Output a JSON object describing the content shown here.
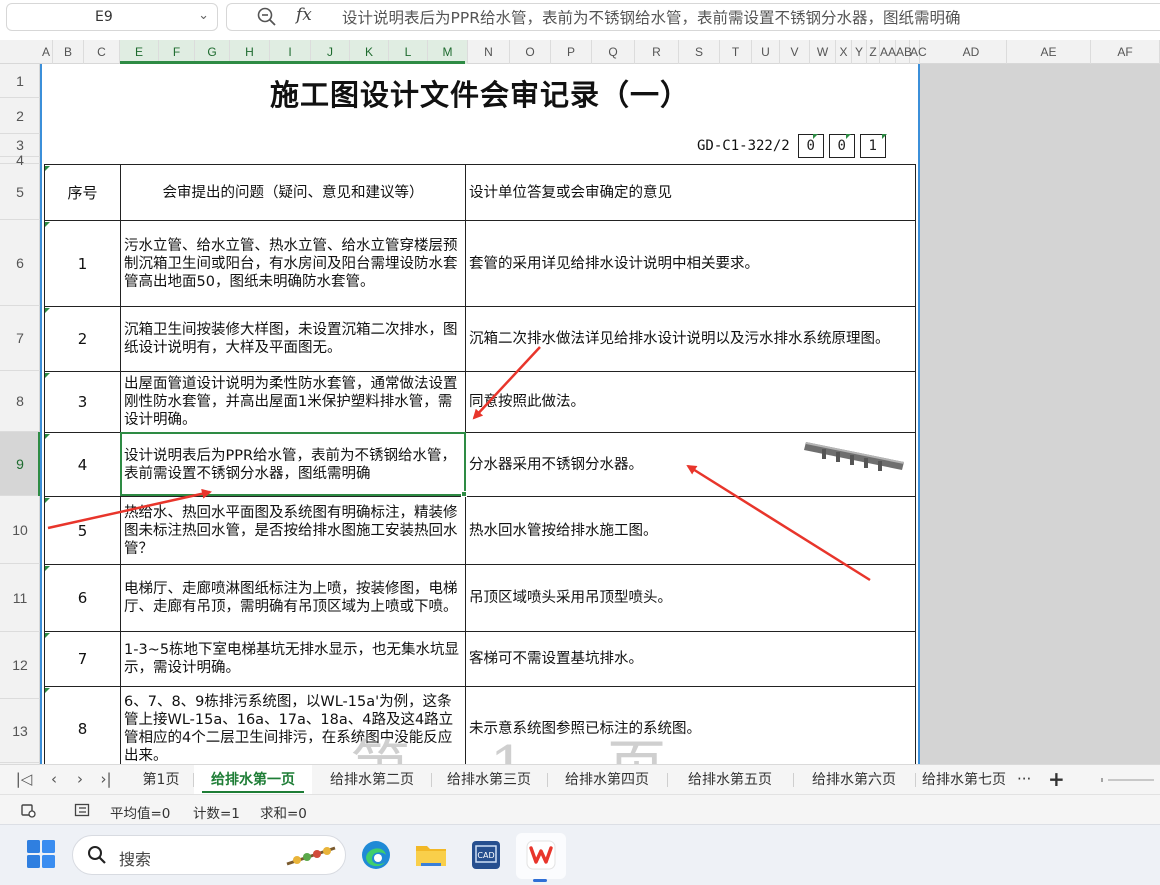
{
  "formula_bar": {
    "cell_ref": "E9",
    "fx_label": "fx",
    "formula": "设计说明表后为PPR给水管，表前为不锈钢给水管，表前需设置不锈钢分水器，图纸需明确"
  },
  "columns": [
    "A",
    "B",
    "C",
    "E",
    "F",
    "G",
    "H",
    "I",
    "J",
    "K",
    "L",
    "M",
    "N",
    "O",
    "P",
    "Q",
    "R",
    "S",
    "T",
    "U",
    "V",
    "W",
    "X",
    "Y",
    "Z",
    "AA",
    "AB",
    "AC",
    "AD",
    "AE",
    "AF"
  ],
  "rows": [
    "1",
    "2",
    "3",
    "4",
    "5",
    "6",
    "7",
    "8",
    "9",
    "10",
    "11",
    "12",
    "13"
  ],
  "document": {
    "title": "施工图设计文件会审记录（一）",
    "code": "GD-C1-322/2",
    "code_boxes": [
      "0",
      "0",
      "1"
    ],
    "headers": {
      "no": "序号",
      "question": "会审提出的问题（疑问、意见和建议等）",
      "answer": "设计单位答复或会审确定的意见"
    },
    "items": [
      {
        "no": "1",
        "question": "污水立管、给水立管、热水立管、给水立管穿楼层预制沉箱卫生间或阳台，有水房间及阳台需埋设防水套管高出地面50，图纸未明确防水套管。",
        "answer": "套管的采用详见给排水设计说明中相关要求。"
      },
      {
        "no": "2",
        "question": "沉箱卫生间按装修大样图，未设置沉箱二次排水，图纸设计说明有，大样及平面图无。",
        "answer": "沉箱二次排水做法详见给排水设计说明以及污水排水系统原理图。"
      },
      {
        "no": "3",
        "question": "出屋面管道设计说明为柔性防水套管，通常做法设置刚性防水套管，并高出屋面1米保护塑料排水管，需设计明确。",
        "answer": "同意按照此做法。"
      },
      {
        "no": "4",
        "question": "设计说明表后为PPR给水管，表前为不锈钢给水管，表前需设置不锈钢分水器，图纸需明确",
        "answer": "分水器采用不锈钢分水器。"
      },
      {
        "no": "5",
        "question": "热给水、热回水平面图及系统图有明确标注，精装修图未标注热回水管，是否按给排水图施工安装热回水管？",
        "answer": "热水回水管按给排水施工图。"
      },
      {
        "no": "6",
        "question": "电梯厅、走廊喷淋图纸标注为上喷，按装修图，电梯厅、走廊有吊顶，需明确有吊顶区域为上喷或下喷。",
        "answer": "吊顶区域喷头采用吊顶型喷头。"
      },
      {
        "no": "7",
        "question": "1-3~5栋地下室电梯基坑无排水显示，也无集水坑显示，需设计明确。",
        "answer": "客梯可不需设置基坑排水。"
      },
      {
        "no": "8",
        "question": "6、7、8、9栋排污系统图，以WL-15a'为例，这条管上接WL-15a、16a、17a、18a、4路及这4路立管相应的4个二层卫生间排污，在系统图中没能反应出来。",
        "answer": "未示意系统图参照已标注的系统图。"
      }
    ],
    "watermark": "第 1 页"
  },
  "sheet_tabs": {
    "tabs": [
      "第1页",
      "给排水第一页",
      "给排水第二页",
      "给排水第三页",
      "给排水第四页",
      "给排水第五页",
      "给排水第六页",
      "给排水第七页"
    ],
    "active": "给排水第一页",
    "more": "···",
    "add": "+"
  },
  "status_bar": {
    "average": "平均值=0",
    "count": "计数=1",
    "sum": "求和=0"
  },
  "taskbar": {
    "search_label": "搜索",
    "apps": [
      "edge-icon",
      "file-explorer-icon",
      "cad-icon",
      "wps-icon"
    ]
  },
  "colors": {
    "accent_green": "#2e8b44",
    "page_border": "#3b8fd9",
    "annotation_red": "#e8352b"
  }
}
